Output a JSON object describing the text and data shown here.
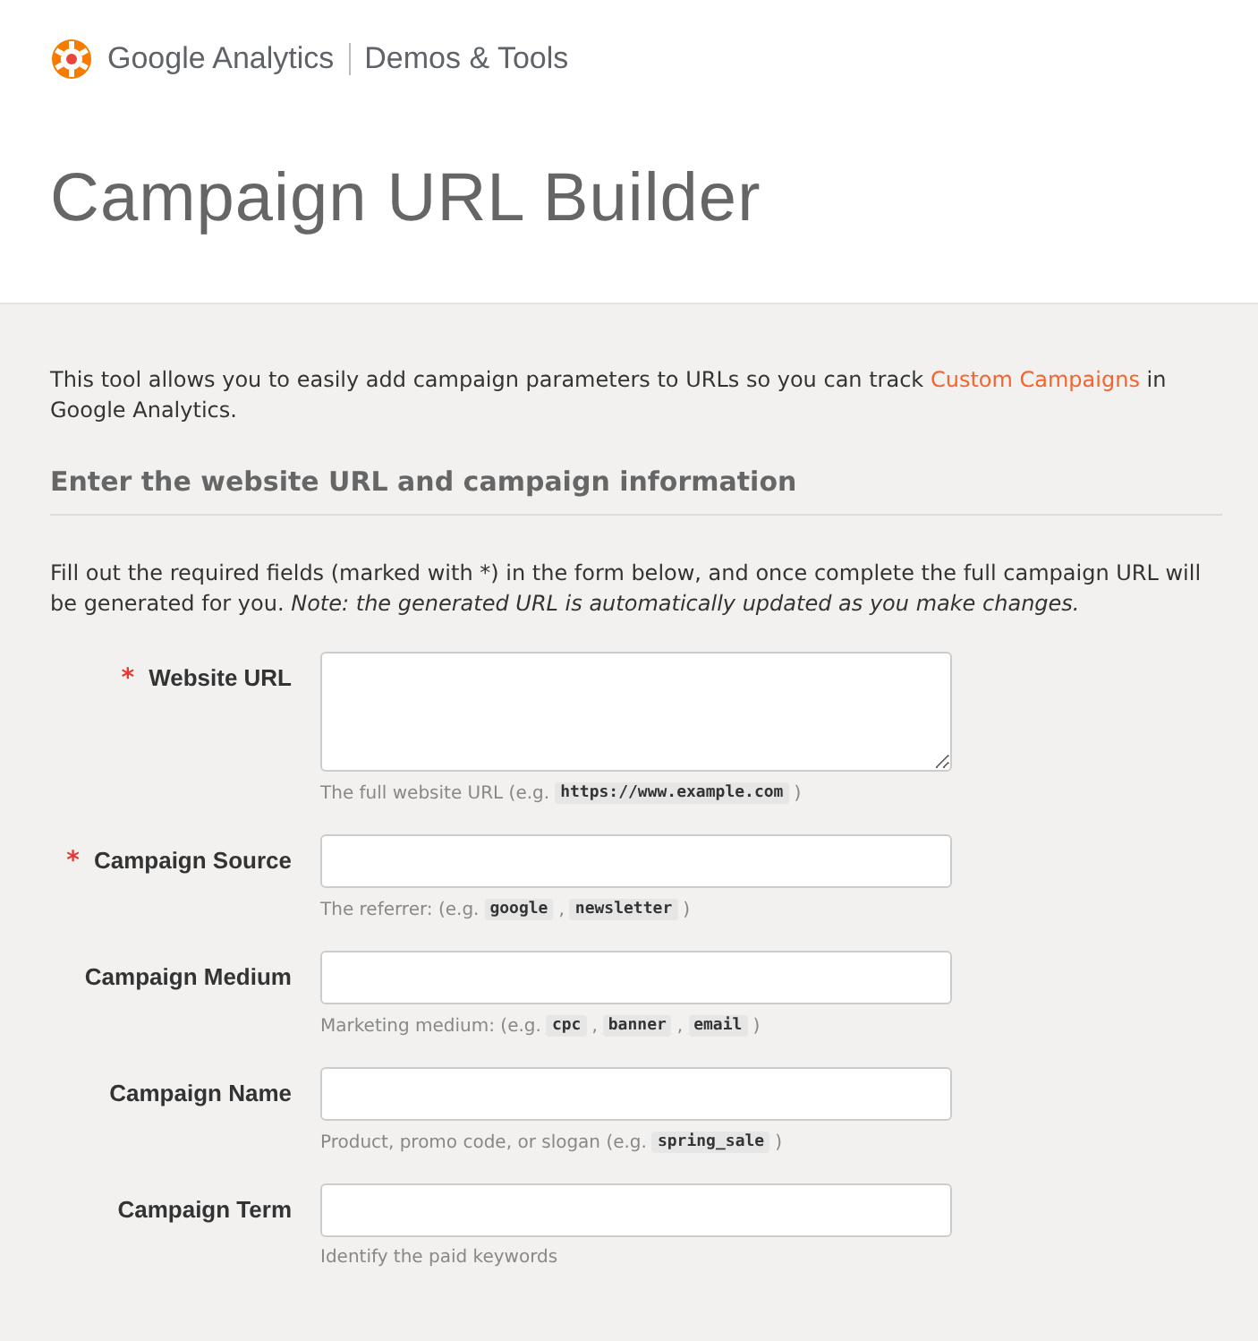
{
  "brand": {
    "product": "Google Analytics",
    "section": "Demos & Tools"
  },
  "title": "Campaign URL Builder",
  "intro": {
    "before": "This tool allows you to easily add campaign parameters to URLs so you can track ",
    "link": "Custom Campaigns",
    "after": " in Google Analytics."
  },
  "required_mark": "*",
  "section_heading": "Enter the website URL and campaign information",
  "instructions": "Fill out the required fields (marked with *) in the form below, and once complete the full campaign URL will be generated for you. *Note: the generated URL is automatically updated as you make changes.*",
  "fields": [
    {
      "label": "Website URL",
      "required": true,
      "kind": "textarea",
      "help": [
        {
          "kind": "text",
          "text": "The full website URL (e.g."
        },
        {
          "kind": "code",
          "text": "https://www.example.com"
        },
        {
          "kind": "text",
          "text": ")"
        }
      ]
    },
    {
      "label": "Campaign Source",
      "required": true,
      "kind": "text",
      "help": [
        {
          "kind": "text",
          "text": "The referrer: (e.g."
        },
        {
          "kind": "code",
          "text": "google"
        },
        {
          "kind": "text",
          "text": ","
        },
        {
          "kind": "code",
          "text": "newsletter"
        },
        {
          "kind": "text",
          "text": ")"
        }
      ]
    },
    {
      "label": "Campaign Medium",
      "required": false,
      "kind": "text",
      "help": [
        {
          "kind": "text",
          "text": "Marketing medium: (e.g."
        },
        {
          "kind": "code",
          "text": "cpc"
        },
        {
          "kind": "text",
          "text": ","
        },
        {
          "kind": "code",
          "text": "banner"
        },
        {
          "kind": "text",
          "text": ","
        },
        {
          "kind": "code",
          "text": "email"
        },
        {
          "kind": "text",
          "text": ")"
        }
      ]
    },
    {
      "label": "Campaign Name",
      "required": false,
      "kind": "text",
      "help": [
        {
          "kind": "text",
          "text": "Product, promo code, or slogan (e.g."
        },
        {
          "kind": "code",
          "text": "spring_sale"
        },
        {
          "kind": "text",
          "text": ")"
        }
      ]
    },
    {
      "label": "Campaign Term",
      "required": false,
      "kind": "text",
      "help": [
        {
          "kind": "text",
          "text": "Identify the paid keywords"
        }
      ]
    }
  ]
}
